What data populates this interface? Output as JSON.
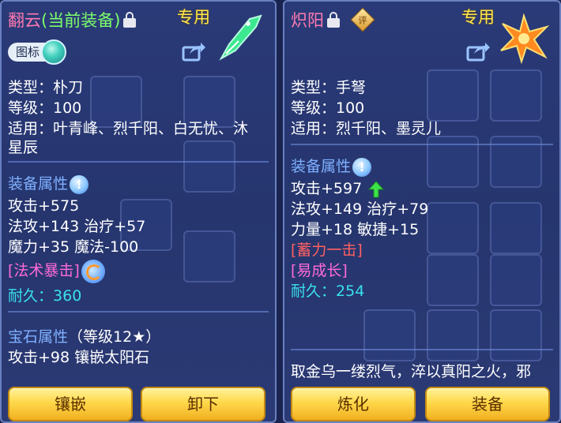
{
  "left": {
    "title_name": "翻云",
    "title_suffix": "(当前装备)",
    "exclusive": "专用",
    "icon_toggle_label": "图标",
    "type": "类型：朴刀",
    "level": "等级：100",
    "applicable_line1": "适用：叶青峰、烈千阳、白无忧、沐",
    "applicable_line2": "星辰",
    "equip_attr_title": "装备属性",
    "attr_line1": "攻击+575",
    "attr_line2": "法攻+143 治疗+57",
    "attr_line3": "魔力+35 魔法-100",
    "special_skill": "[法术暴击]",
    "durability_label": "耐久：",
    "durability_value": "360",
    "gem_title": "宝石属性",
    "gem_level": "（等级12★）",
    "gem_line": "攻击+98 镶嵌太阳石",
    "buttons": {
      "inlay": "镶嵌",
      "unequip": "卸下"
    }
  },
  "right": {
    "title_name": "炽阳",
    "badge": "评",
    "exclusive": "专用",
    "type": "类型：手弩",
    "level": "等级：100",
    "applicable": "适用：烈千阳、墨灵儿",
    "equip_attr_title": "装备属性",
    "attr_line1": "攻击+597",
    "attr_line2": "法攻+149 治疗+79",
    "attr_line3": "力量+18 敏捷+15",
    "special1": "[蓄力一击]",
    "special2": "[易成长]",
    "durability_label": "耐久：",
    "durability_value": "254",
    "description": "取金乌一缕烈气，淬以真阳之火，邪",
    "buttons": {
      "refine": "炼化",
      "equip": "装备"
    }
  },
  "colors": {
    "panel_bg": "#2a3a78",
    "title_pink": "#ff7ab0",
    "current_green": "#7cff6a",
    "exclusive_yellow": "#ffe84a",
    "section_blue": "#7fb0ff",
    "cyan": "#39e0ee",
    "red": "#ff6060",
    "magenta": "#ff6ad8",
    "button_gold": "#ffd84a"
  },
  "icons": {
    "lock": "lock-icon",
    "share": "share-icon",
    "info": "info-icon",
    "upgrade": "up-arrow-icon",
    "weapon_left": "green-blade-icon",
    "weapon_right": "flame-crossbow-icon"
  }
}
